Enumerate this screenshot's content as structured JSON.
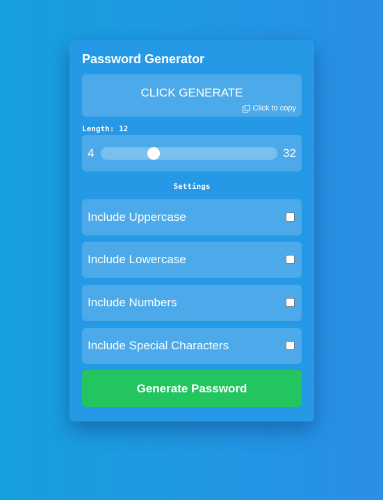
{
  "app": {
    "title": "Password Generator"
  },
  "result": {
    "text": "CLICK GENERATE",
    "copy_hint": "Click to copy",
    "copy_icon": "copy-icon"
  },
  "length": {
    "label": "Length: 12",
    "min": "4",
    "max": "32",
    "value": 12,
    "min_value": 4,
    "max_value": 32
  },
  "settings": {
    "label": "Settings",
    "options": [
      {
        "label": "Include Uppercase",
        "checked": false
      },
      {
        "label": "Include Lowercase",
        "checked": false
      },
      {
        "label": "Include Numbers",
        "checked": false
      },
      {
        "label": "Include Special Characters",
        "checked": false
      }
    ]
  },
  "actions": {
    "generate_label": "Generate Password"
  },
  "colors": {
    "background": "#1ea0e0",
    "card": "#2598e6",
    "button": "#22c55e"
  }
}
